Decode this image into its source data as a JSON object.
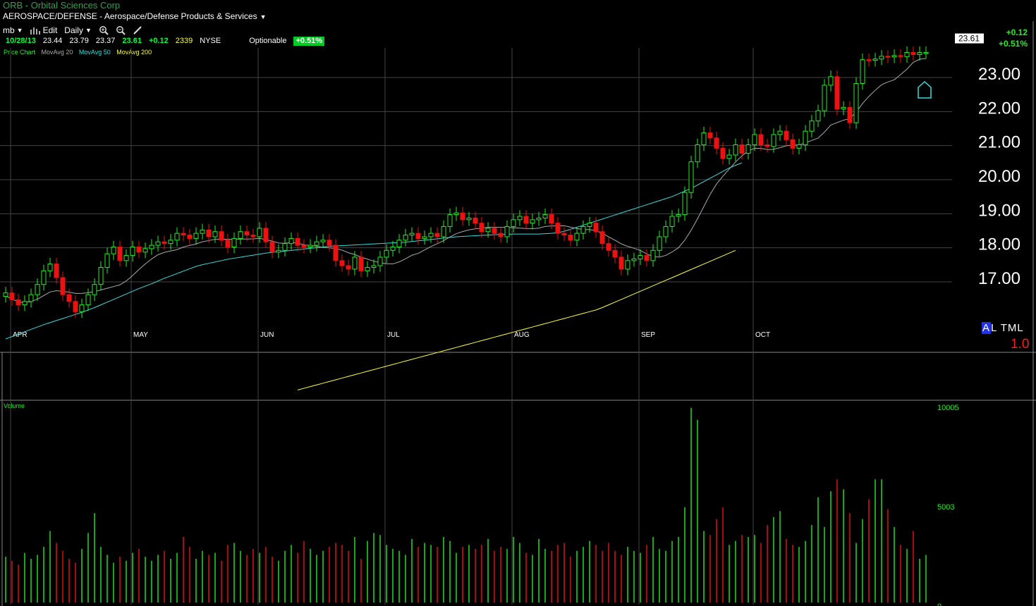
{
  "header": {
    "title": "ORB - Orbital Sciences Corp",
    "sector": "AEROSPACE/DEFENSE - Aerospace/Defense Products & Services"
  },
  "toolbar": {
    "layout_label": "mb",
    "edit_label": "Edit",
    "period_label": "Daily"
  },
  "quote": {
    "date": "10/28/13",
    "open": "23.44",
    "high": "23.79",
    "low": "23.37",
    "last": "23.61",
    "change": "+0.12",
    "volume": "2339",
    "exchange": "NYSE",
    "optionable": "Optionable",
    "change_pct": "+0.51%"
  },
  "right_summary": {
    "change": "+0.12",
    "change_pct": "+0.51%"
  },
  "legend": {
    "price_chart": "Price Chart",
    "ma20": "MovAvg 20",
    "ma50": "MovAvg 50",
    "ma200": "MovAvg 200",
    "colors": {
      "price_chart": "#22ee22",
      "ma20": "#aaaaaa",
      "ma50": "#33dddd",
      "ma200": "#ffff33"
    }
  },
  "indicator": {
    "label": "ALTML",
    "value": "1.0"
  },
  "volume_panel": {
    "label": "Volume"
  },
  "colors": {
    "up": "#22ee22",
    "down": "#ee1111",
    "grid": "#444444",
    "background": "#000000"
  },
  "chart_data": {
    "type": "candlestick",
    "ticker": "ORB",
    "period": "Daily",
    "y_ticks": [
      "23.00",
      "22.00",
      "21.00",
      "20.00",
      "19.00",
      "18.00",
      "17.00"
    ],
    "y_range": [
      16.0,
      23.8
    ],
    "last_price_label": "23.61",
    "x_labels": [
      "APR",
      "MAY",
      "JUN",
      "JUL",
      "AUG",
      "SEP",
      "OCT"
    ],
    "volume_ticks": [
      "10005",
      "5003",
      "0"
    ],
    "volume_range": [
      0,
      10005
    ],
    "sessions": 146,
    "label_session_index": [
      1,
      20,
      40,
      60,
      80,
      100,
      118
    ],
    "closes": [
      16.55,
      16.35,
      16.2,
      16.3,
      16.5,
      16.8,
      17.2,
      17.4,
      17.0,
      16.5,
      16.3,
      16.0,
      16.2,
      16.5,
      16.8,
      17.3,
      17.7,
      17.9,
      17.5,
      17.65,
      17.9,
      17.75,
      17.85,
      17.95,
      18.05,
      18.0,
      18.1,
      18.3,
      18.25,
      18.15,
      18.3,
      18.4,
      18.2,
      18.35,
      18.1,
      17.9,
      18.15,
      18.35,
      18.25,
      18.2,
      18.45,
      18.05,
      17.75,
      17.8,
      18.0,
      18.15,
      17.95,
      17.9,
      17.95,
      18.05,
      18.1,
      17.95,
      17.5,
      17.35,
      17.25,
      17.6,
      17.2,
      17.3,
      17.35,
      17.6,
      17.8,
      17.9,
      18.1,
      18.25,
      18.3,
      18.15,
      18.2,
      18.3,
      18.2,
      18.5,
      18.85,
      18.9,
      18.7,
      18.75,
      18.6,
      18.35,
      18.45,
      18.3,
      18.2,
      18.5,
      18.7,
      18.8,
      18.6,
      18.7,
      18.75,
      18.85,
      18.6,
      18.3,
      18.25,
      18.1,
      18.3,
      18.5,
      18.6,
      18.35,
      18.0,
      17.8,
      17.6,
      17.25,
      17.5,
      17.55,
      17.65,
      17.5,
      17.8,
      18.2,
      18.5,
      18.8,
      18.85,
      19.5,
      20.4,
      20.9,
      21.25,
      21.1,
      20.8,
      20.5,
      20.6,
      20.9,
      20.65,
      20.9,
      21.2,
      20.9,
      20.85,
      21.2,
      21.3,
      21.05,
      20.8,
      20.9,
      21.3,
      21.6,
      21.9,
      22.65,
      22.9,
      21.95,
      22.0,
      21.55,
      22.7,
      23.4,
      23.38,
      23.42,
      23.5,
      23.48,
      23.52,
      23.49,
      23.61,
      23.55,
      23.61,
      23.61
    ],
    "ma20_start_index": 0,
    "ma20": [
      16.3,
      16.45,
      16.6,
      16.72,
      16.8,
      16.85,
      16.9,
      16.95,
      17.0,
      17.02,
      17.05,
      17.1,
      17.15,
      17.2,
      17.3,
      17.4,
      17.5,
      17.6,
      17.68,
      17.75,
      17.8,
      17.85,
      17.9,
      17.95,
      17.98,
      18.0,
      18.02,
      18.03,
      18.05,
      18.07,
      18.1,
      18.1,
      18.12,
      18.1,
      18.05,
      18.0,
      17.97,
      17.95,
      17.93,
      17.9,
      17.87,
      17.85,
      17.82,
      17.8,
      17.78,
      17.75,
      17.73,
      17.72,
      17.71,
      17.7,
      17.7,
      17.72,
      17.74,
      17.77,
      17.8,
      17.84,
      17.88,
      17.9,
      17.93,
      17.95,
      18.0,
      18.05,
      18.1,
      18.15,
      18.2,
      18.27,
      18.33,
      18.38,
      18.43,
      18.47,
      18.5,
      18.52,
      18.53,
      18.54,
      18.55,
      18.55,
      18.55,
      18.53,
      18.5,
      18.45,
      18.4,
      18.32,
      18.22,
      18.1,
      17.98,
      17.88,
      17.82,
      17.8,
      17.85,
      17.95,
      18.1,
      18.3,
      18.55,
      18.85,
      19.15,
      19.45,
      19.75,
      20.05,
      20.3,
      20.55,
      20.7,
      20.8,
      20.9,
      21.0,
      21.1,
      21.2,
      21.3,
      21.4,
      21.5,
      21.63,
      21.76,
      21.9,
      22.05,
      22.15,
      22.25,
      22.35
    ],
    "ma20_index_offset": 30,
    "ma50": [
      15.2,
      15.27,
      15.34,
      15.41,
      15.48,
      15.55,
      15.62,
      15.68,
      15.74,
      15.8,
      15.86,
      15.92,
      15.98,
      16.05,
      16.12,
      16.2,
      16.28,
      16.36,
      16.44,
      16.52,
      16.6,
      16.68,
      16.75,
      16.82,
      16.9,
      16.98,
      17.05,
      17.12,
      17.19,
      17.26,
      17.33,
      17.38,
      17.42,
      17.46,
      17.5,
      17.54,
      17.57,
      17.6,
      17.63,
      17.66,
      17.69,
      17.72,
      17.74,
      17.76,
      17.78,
      17.8,
      17.82,
      17.84,
      17.86,
      17.88,
      17.9,
      17.92,
      17.93,
      17.94,
      17.95,
      17.96,
      17.97,
      17.98,
      17.99,
      18.0,
      18.01,
      18.02,
      18.03,
      18.04,
      18.06,
      18.08,
      18.1,
      18.12,
      18.14,
      18.16,
      18.18,
      18.2,
      18.21,
      18.22,
      18.23,
      18.24,
      18.25,
      18.26,
      18.27,
      18.27,
      18.28,
      18.28,
      18.28,
      18.28,
      18.28,
      18.29,
      18.3,
      18.32,
      18.36,
      18.42,
      18.48,
      18.54,
      18.6,
      18.66,
      18.72,
      18.78,
      18.84,
      18.9,
      18.96,
      19.02,
      19.08,
      19.14,
      19.2,
      19.26,
      19.32,
      19.38,
      19.46,
      19.54,
      19.62,
      19.72,
      19.82,
      19.92,
      20.02,
      20.12,
      20.22,
      20.3,
      20.37
    ],
    "ma200": [
      13.7,
      13.75,
      13.8,
      13.85,
      13.9,
      13.95,
      14.0,
      14.05,
      14.1,
      14.15,
      14.2,
      14.25,
      14.3,
      14.35,
      14.4,
      14.45,
      14.5,
      14.55,
      14.6,
      14.65,
      14.7,
      14.75,
      14.8,
      14.85,
      14.9,
      14.95,
      15.0,
      15.05,
      15.1,
      15.15,
      15.2,
      15.25,
      15.3,
      15.35,
      15.4,
      15.45,
      15.5,
      15.55,
      15.6,
      15.65,
      15.7,
      15.75,
      15.8,
      15.85,
      15.9,
      15.95,
      16.0,
      16.05,
      16.12,
      16.2,
      16.28,
      16.36,
      16.44,
      16.52,
      16.6,
      16.68,
      16.76,
      16.84,
      16.92,
      17.0,
      17.08,
      17.16,
      17.24,
      17.32,
      17.4,
      17.48,
      17.56,
      17.64,
      17.72,
      17.8
    ],
    "volume": [
      2300,
      2100,
      1900,
      2500,
      2200,
      2400,
      2800,
      3600,
      3000,
      2600,
      2200,
      2000,
      2700,
      3500,
      4500,
      2800,
      2400,
      2000,
      2300,
      2100,
      2500,
      2700,
      2300,
      2100,
      2400,
      2600,
      2200,
      2500,
      3300,
      2800,
      2200,
      2600,
      2400,
      2500,
      2100,
      2900,
      3000,
      2600,
      2400,
      2700,
      2500,
      2800,
      2300,
      2100,
      2600,
      2900,
      2500,
      3100,
      2700,
      2400,
      2600,
      2800,
      3000,
      2900,
      2600,
      3300,
      2200,
      3100,
      3500,
      3400,
      2900,
      2700,
      2600,
      2400,
      3200,
      2800,
      3000,
      2900,
      2800,
      3300,
      3100,
      2500,
      2800,
      2900,
      2700,
      2900,
      3200,
      2600,
      2800,
      2700,
      3300,
      3000,
      2500,
      2400,
      3200,
      2700,
      2600,
      2900,
      3000,
      2300,
      2600,
      2800,
      3100,
      2900,
      2600,
      3000,
      2600,
      2400,
      2800,
      2600,
      2500,
      2900,
      3300,
      2700,
      2600,
      3100,
      3300,
      4800,
      9800,
      9200,
      3600,
      3400,
      4200,
      4800,
      2900,
      3100,
      3400,
      3300,
      3400,
      3000,
      3900,
      4300,
      4600,
      3200,
      2900,
      2800,
      3100,
      3900,
      5300,
      3800,
      5600,
      6200,
      5700,
      4500,
      3000,
      4200,
      5200,
      6200,
      6200,
      4700,
      3800,
      2900,
      2700,
      3600,
      2200,
      2400
    ]
  }
}
